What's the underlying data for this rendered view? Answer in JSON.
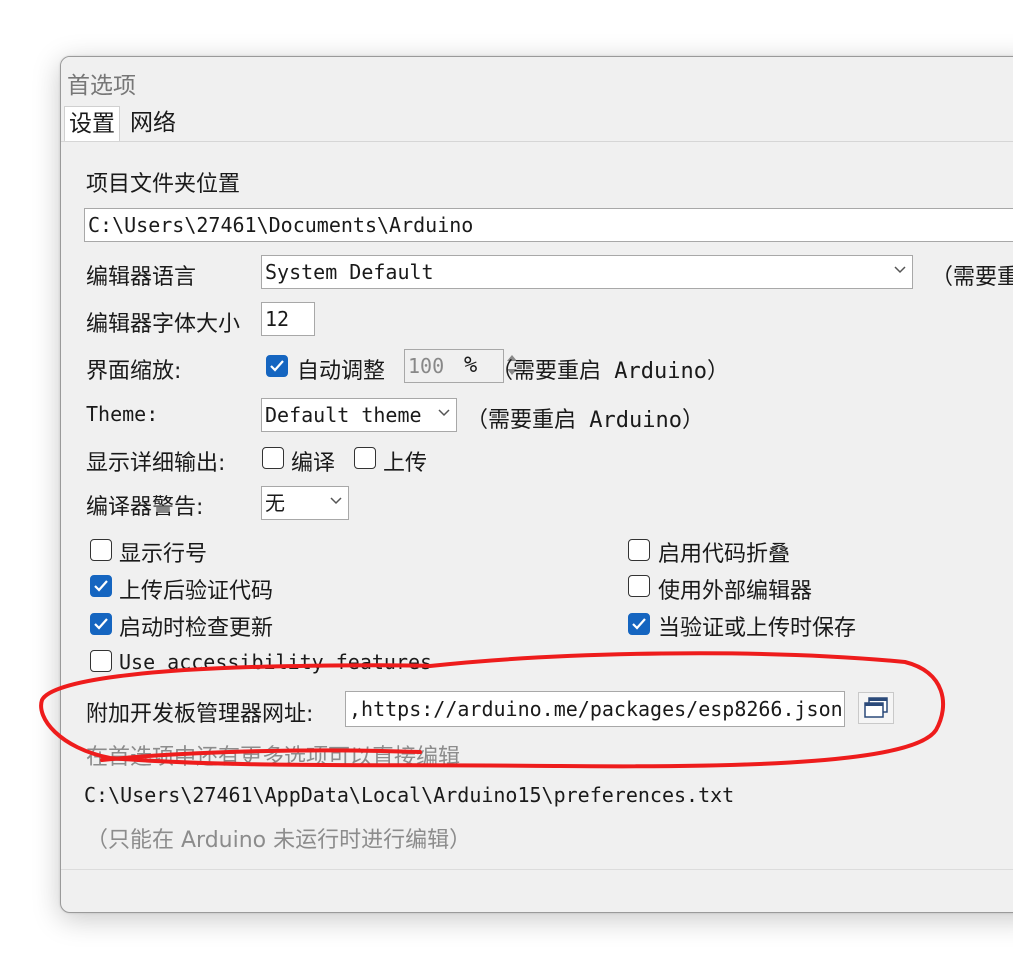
{
  "window": {
    "title": "首选项"
  },
  "tabs": [
    {
      "label": "设置",
      "active": true
    },
    {
      "label": "网络",
      "active": false
    }
  ],
  "sketchbook": {
    "label": "项目文件夹位置",
    "value": "C:\\Users\\27461\\Documents\\Arduino"
  },
  "editor_language": {
    "label": "编辑器语言",
    "value": "System Default",
    "note": "（需要重"
  },
  "font_size": {
    "label": "编辑器字体大小",
    "value": "12"
  },
  "scale": {
    "label": "界面缩放:",
    "auto_label": "自动调整",
    "auto_checked": true,
    "value": "100",
    "unit": "%",
    "note": "（需要重启 Arduino）"
  },
  "theme": {
    "label": "Theme:",
    "value": "Default theme",
    "note": "（需要重启 Arduino）"
  },
  "verbose": {
    "label": "显示详细输出:",
    "compile_label": "编译",
    "compile_checked": false,
    "upload_label": "上传",
    "upload_checked": false
  },
  "warnings": {
    "label": "编译器警告:",
    "value": "无"
  },
  "options": {
    "show_line_numbers": {
      "label": "显示行号",
      "checked": false
    },
    "verify_after_upload": {
      "label": "上传后验证代码",
      "checked": true
    },
    "check_updates": {
      "label": "启动时检查更新",
      "checked": true
    },
    "accessibility": {
      "label": "Use accessibility features",
      "checked": false
    },
    "code_folding": {
      "label": "启用代码折叠",
      "checked": false
    },
    "external_editor": {
      "label": "使用外部编辑器",
      "checked": false
    },
    "save_on_verify": {
      "label": "当验证或上传时保存",
      "checked": true
    }
  },
  "board_urls": {
    "label": "附加开发板管理器网址:",
    "value": ",https://arduino.me/packages/esp8266.json",
    "button_icon": "window-list-icon"
  },
  "more_prefs": {
    "hint": "在首选项中还有更多选项可以直接编辑",
    "path": "C:\\Users\\27461\\AppData\\Local\\Arduino15\\preferences.txt",
    "note": "（只能在 Arduino 未运行时进行编辑）"
  },
  "annotation": {
    "color": "#ee1c1c"
  },
  "colors": {
    "accent": "#1565c0",
    "window_bg": "#f0f0f0"
  }
}
